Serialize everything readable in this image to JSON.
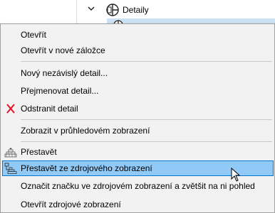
{
  "tree": {
    "node_label": "Detaily",
    "icons": [
      "chevron-down-icon",
      "details-folder-icon",
      "detail-viewpoint-icon"
    ]
  },
  "menu": {
    "items": [
      {
        "label": "Otevřít",
        "icon": null
      },
      {
        "label": "Otevřít v nové záložce",
        "icon": null
      },
      {
        "label": "Nový nezávislý detail...",
        "icon": null
      },
      {
        "label": "Přejmenovat detail...",
        "icon": null
      },
      {
        "label": "Odstranit detail",
        "icon": "delete-x-icon"
      },
      {
        "label": "Zobrazit v průhledovém zobrazení",
        "icon": null
      },
      {
        "label": "Přestavět",
        "icon": "rebuild-icon"
      },
      {
        "label": "Přestavět ze zdrojového zobrazení",
        "icon": "rebuild-from-source-icon",
        "highlighted": true
      },
      {
        "label": "Označit značku ve zdrojovém zobrazení a zvětšit na ni pohled",
        "icon": null
      },
      {
        "label": "Otevřít zdrojové zobrazení",
        "icon": null
      }
    ]
  },
  "colors": {
    "highlight_bg": "#91c9f7",
    "highlight_border": "#0078d7",
    "menu_bg": "#f2f2f2",
    "delete_icon": "#e81123"
  }
}
